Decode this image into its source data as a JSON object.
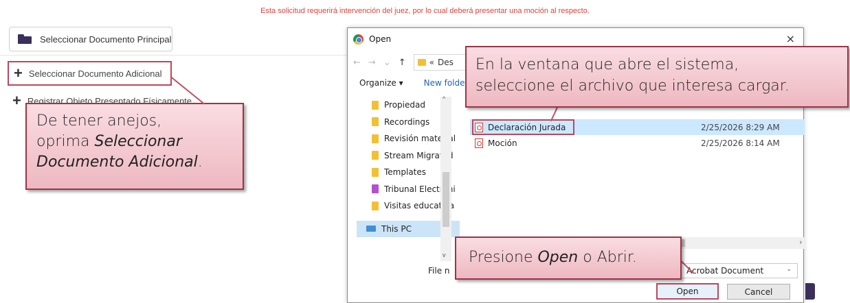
{
  "page": {
    "warning": "Esta solicitud requerirá intervención del juez, por lo cual deberá presentar una moción al respecto.",
    "main_doc_button": "Seleccionar Documento Principal",
    "additional_doc_button": "Seleccionar Documento Adicional",
    "object_button": "Registrar Objeto Presentado Físicamente"
  },
  "callouts": {
    "left_line1": "De tener anejos,",
    "left_line2": "oprima",
    "left_em1": "Seleccionar",
    "left_em2": "Documento Adicional",
    "left_end": ".",
    "top_line1": "En la ventana que abre el sistema,",
    "top_line2": "seleccione el archivo que interesa cargar.",
    "bottom_pre": "Presione ",
    "bottom_em": "Open",
    "bottom_post": " o Abrir."
  },
  "dialog": {
    "title": "Open",
    "close": "×",
    "address": {
      "back": "←",
      "forward": "→",
      "history": "⌄",
      "up": "↑",
      "sep": "«",
      "path": "Des"
    },
    "toolbar": {
      "organize": "Organize ▾",
      "new_folder": "New folder"
    },
    "nav_items": [
      {
        "label": "Propiedad",
        "color": "yellow"
      },
      {
        "label": "Recordings",
        "color": "yellow"
      },
      {
        "label": "Revisión material",
        "color": "yellow"
      },
      {
        "label": "Stream Migrated",
        "color": "yellow"
      },
      {
        "label": "Templates",
        "color": "yellow"
      },
      {
        "label": "Tribunal Electróni",
        "color": "purple"
      },
      {
        "label": "Visitas educativa",
        "color": "yellow"
      }
    ],
    "this_pc": "This PC",
    "files": [
      {
        "name": "Declaración Jurada",
        "date": "2/25/2026 8:29 AM"
      },
      {
        "name": "Moción",
        "date": "2/25/2026 8:14 AM"
      }
    ],
    "filename_label": "File n",
    "filetype": "Acrobat Document",
    "open_label": "Open",
    "cancel_label": "Cancel"
  },
  "colors": {
    "warning": "#e0413a",
    "highlight_border": "#b9475a",
    "callout_fill": "#f4c9d0",
    "brand_purple": "#3b2f5c"
  }
}
